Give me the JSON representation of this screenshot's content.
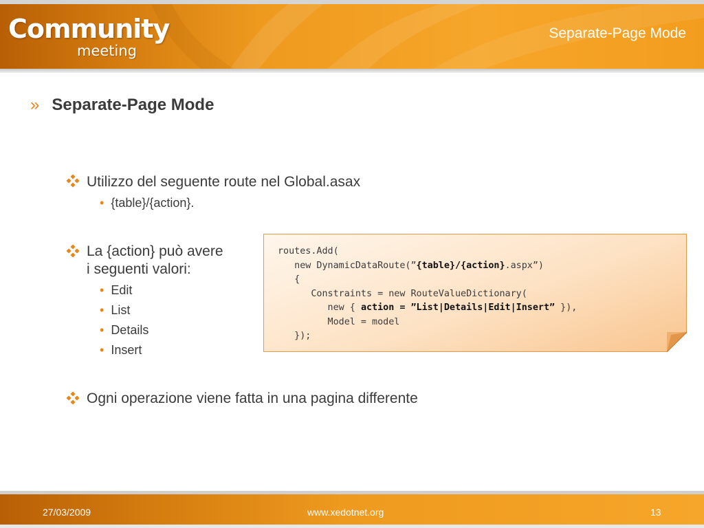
{
  "header": {
    "logo_main": "Community",
    "logo_sub": "meeting",
    "title": "Separate-Page Mode"
  },
  "slide": {
    "heading_marker": "»",
    "heading": "Separate-Page Mode",
    "bullets": [
      {
        "text": "Utilizzo del seguente route nel Global.asax",
        "subitems": [
          "{table}/{action}."
        ]
      },
      {
        "line1": "La {action} può avere",
        "line2": "i seguenti valori:",
        "subitems": [
          "Edit",
          "List",
          "Details",
          "Insert"
        ]
      },
      {
        "text": "Ogni operazione viene fatta in una pagina differente"
      }
    ],
    "sub_marker": "•"
  },
  "code": {
    "l1": "routes.Add(",
    "l2_a": "   new DynamicDataRoute(”",
    "l2_b": "{table}/{action}",
    "l2_c": ".aspx”)",
    "l3": "   {",
    "l4": "      Constraints = new RouteValueDictionary(",
    "l5_a": "         new { ",
    "l5_b": "action = ”List|Details|Edit|Insert”",
    "l5_c": " }),",
    "l6": "         Model = model",
    "l7": "   });"
  },
  "footer": {
    "date": "27/03/2009",
    "website": "www.xedotnet.org",
    "page_number": "13"
  },
  "colors": {
    "accent_orange": "#e8861a",
    "banner_orange": "#f39d1e",
    "text_dark": "#3b3b3b",
    "note_border": "#e39a4d"
  }
}
